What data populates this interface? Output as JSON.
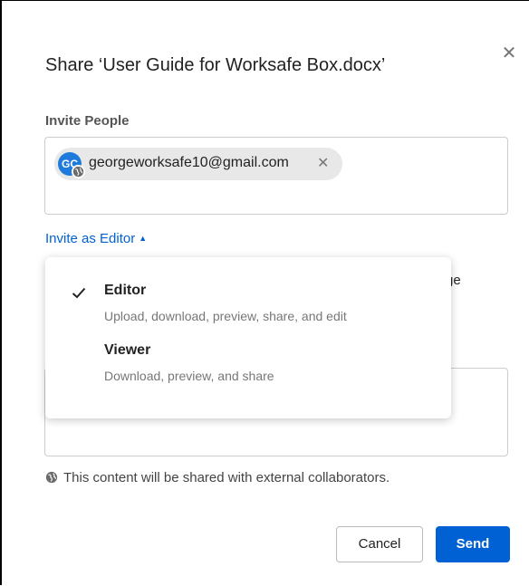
{
  "dialog": {
    "title": "Share ‘User Guide for Worksafe Box.docx’",
    "close_icon": "close-icon"
  },
  "invite": {
    "section_label": "Invite People",
    "recipients": [
      {
        "initials": "GC",
        "email": "georgeworksafe10@gmail.com",
        "badge_icon": "globe-icon",
        "remove_icon": "close-icon"
      }
    ],
    "invite_as_label": "Invite as Editor",
    "caret_icon": "caret-up-icon"
  },
  "obscured_text": "ge",
  "role_menu": {
    "selected": "Editor",
    "options": [
      {
        "label": "Editor",
        "description": "Upload, download, preview, share, and edit",
        "checked": true
      },
      {
        "label": "Viewer",
        "description": "Download, preview, and share",
        "checked": false
      }
    ]
  },
  "external_note": "This content will be shared with external collaborators.",
  "buttons": {
    "cancel": "Cancel",
    "send": "Send"
  },
  "colors": {
    "accent": "#0061d5",
    "avatar": "#1f7bdb",
    "pill_bg": "#e8e8e8"
  }
}
